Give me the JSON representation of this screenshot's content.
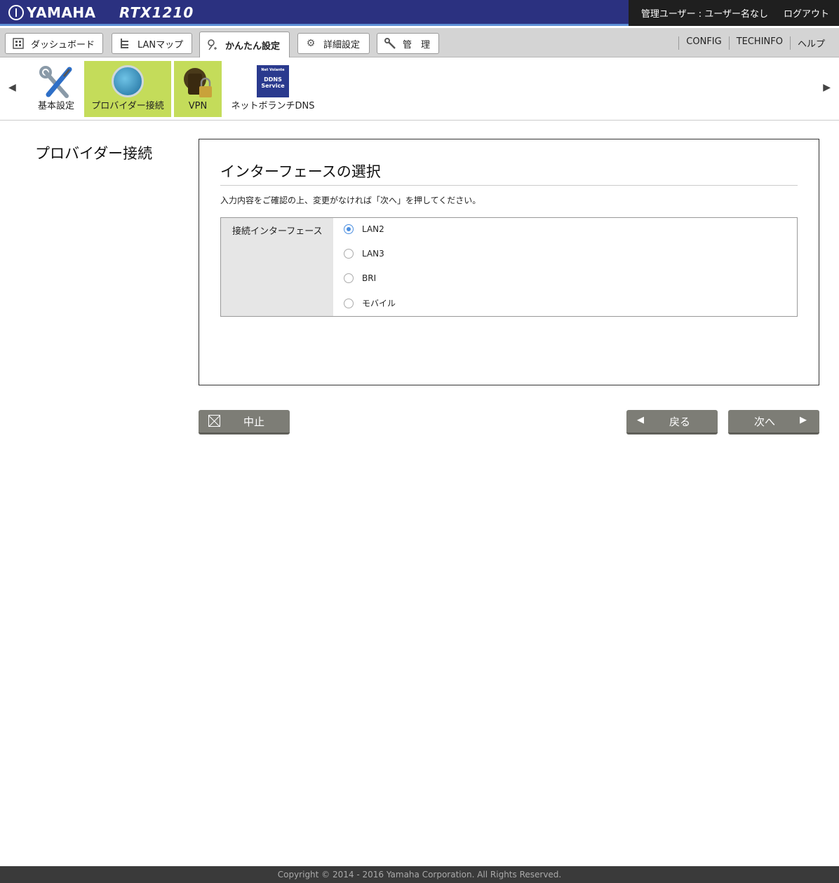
{
  "header": {
    "brand": "YAMAHA",
    "model": "RTX1210",
    "user": "管理ユーザー : ユーザー名なし",
    "logout": "ログアウト"
  },
  "tabs": [
    {
      "label": "ダッシュボード",
      "icon": "dashboard-icon"
    },
    {
      "label": "LANマップ",
      "icon": "lan-map-icon"
    },
    {
      "label": "かんたん設定",
      "icon": "easy-setup-icon",
      "active": true
    },
    {
      "label": "詳細設定",
      "icon": "gear-icon"
    },
    {
      "label": "管　理",
      "icon": "wrench-icon"
    }
  ],
  "top_links": [
    "CONFIG",
    "TECHINFO",
    "ヘルプ"
  ],
  "icon_nav": [
    {
      "label": "基本設定",
      "icon": "tools-icon"
    },
    {
      "label": "プロバイダー接続",
      "icon": "globe-icon",
      "active": true
    },
    {
      "label": "VPN",
      "icon": "lock-icon",
      "active": true
    },
    {
      "label": "ネットボランチDNS",
      "icon": "ddns-icon",
      "badge": "DDNS Service",
      "badge_top": "Net Volante"
    }
  ],
  "page_title": "プロバイダー接続",
  "panel": {
    "title": "インターフェースの選択",
    "message": "入力内容をご確認の上、変更がなければ「次へ」を押してください。",
    "field_label": "接続インターフェース",
    "options": [
      {
        "label": "LAN2",
        "selected": true
      },
      {
        "label": "LAN3",
        "selected": false
      },
      {
        "label": "BRI",
        "selected": false
      },
      {
        "label": "モバイル",
        "selected": false
      }
    ]
  },
  "buttons": {
    "cancel": "中止",
    "back": "戻る",
    "next": "次へ",
    "back_arrow": "◀",
    "next_arrow": "▶"
  },
  "footer": "Copyright © 2014 - 2016 Yamaha Corporation. All Rights Reserved.",
  "colors": {
    "header_bg": "#2b3180",
    "active_nav": "#c4dc5a",
    "radio_accent": "#4a8ee0",
    "button_bg": "#7d7d76"
  }
}
